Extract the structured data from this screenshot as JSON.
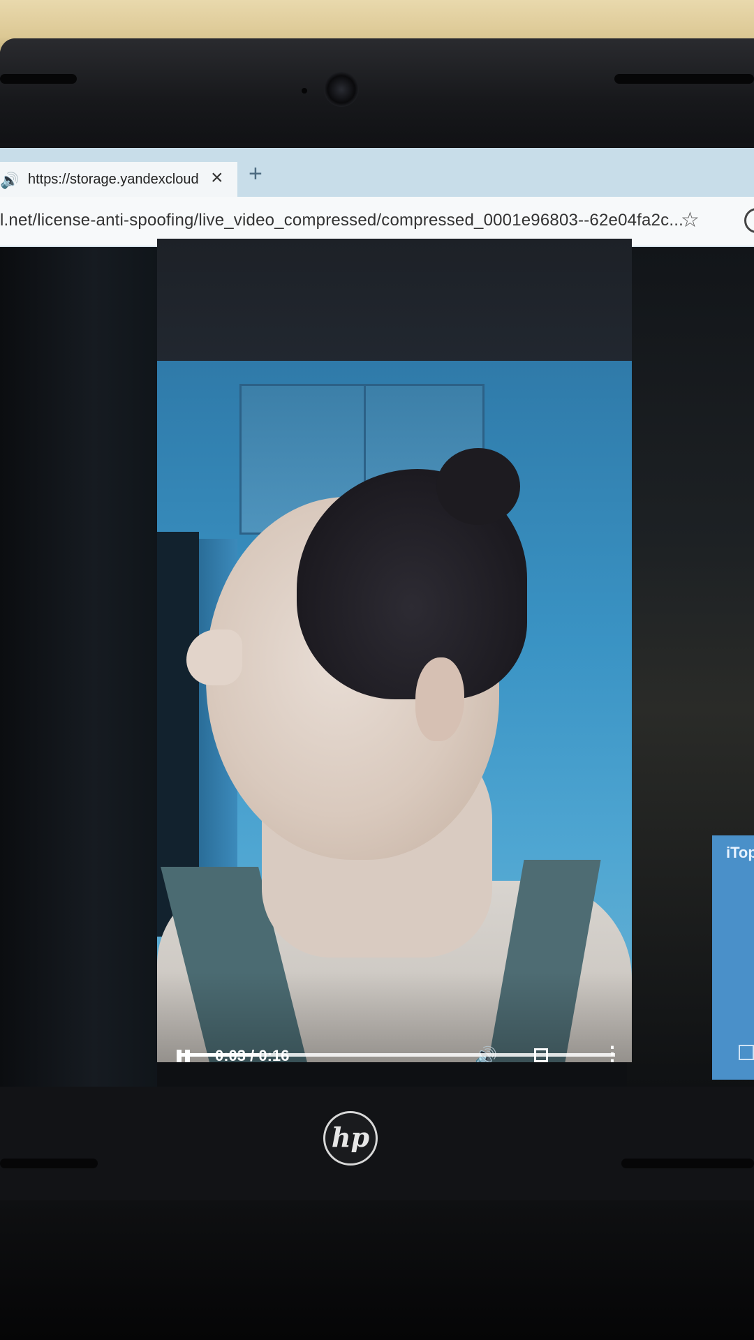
{
  "browser": {
    "tab_title": "https://storage.yandexcloud",
    "tab_close": "×",
    "new_tab": "+",
    "url": "l.net/license-anti-spoofing/live_video_compressed/compressed_0001e96803--62e04fa2c..."
  },
  "video_player": {
    "time_display": "0:03 / 0:16",
    "current_seconds": 3,
    "duration_seconds": 16,
    "state": "playing"
  },
  "side_popup": {
    "title": "iTop"
  },
  "hardware": {
    "logo": "hp"
  },
  "icons": {
    "tab_audio": "speaker-icon",
    "favorite": "star-add-icon",
    "play_pause": "pause-icon",
    "volume": "volume-icon",
    "fullscreen": "fullscreen-icon",
    "more": "more-vertical-icon"
  }
}
